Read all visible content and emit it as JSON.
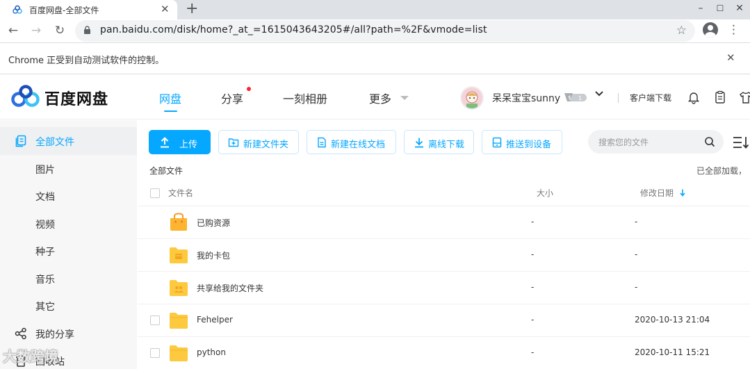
{
  "browser": {
    "tab_title": "百度网盘-全部文件",
    "tab_close": "✕",
    "new_tab": "+",
    "url": "pan.baidu.com/disk/home?_at_=1615043643205#/all?path=%2F&vmode=list",
    "infobar_message": "Chrome 正受到自动测试软件的控制。",
    "infobar_close": "✕"
  },
  "header": {
    "logo_text": "百度网盘",
    "nav": [
      "网盘",
      "分享",
      "一刻相册",
      "更多"
    ],
    "username": "呆呆宝宝sunny",
    "client_download": "客户端下载"
  },
  "sidebar": {
    "items": [
      "全部文件",
      "图片",
      "文档",
      "视频",
      "种子",
      "音乐",
      "其它",
      "我的分享",
      "回收站"
    ]
  },
  "toolbar": {
    "upload": "上传",
    "new_folder": "新建文件夹",
    "new_doc": "新建在线文档",
    "offline_download": "离线下载",
    "push_device": "推送到设备",
    "search_placeholder": "搜索您的文件"
  },
  "breadcrumb": "全部文件",
  "loaded_status": "已全部加载，",
  "table": {
    "headers": {
      "name": "文件名",
      "size": "大小",
      "date": "修改日期"
    },
    "rows": [
      {
        "name": "已购资源",
        "size": "-",
        "date": "-"
      },
      {
        "name": "我的卡包",
        "size": "-",
        "date": "-"
      },
      {
        "name": "共享给我的文件夹",
        "size": "-",
        "date": "-"
      },
      {
        "name": "Fehelper",
        "size": "-",
        "date": "2020-10-13 21:04"
      },
      {
        "name": "python",
        "size": "-",
        "date": "2020-10-11 15:21"
      }
    ]
  },
  "watermark": "大数跨境",
  "colors": {
    "accent": "#06a7ff",
    "folder": "#fcc93f",
    "sidebar_bg": "#f7f7f8"
  }
}
